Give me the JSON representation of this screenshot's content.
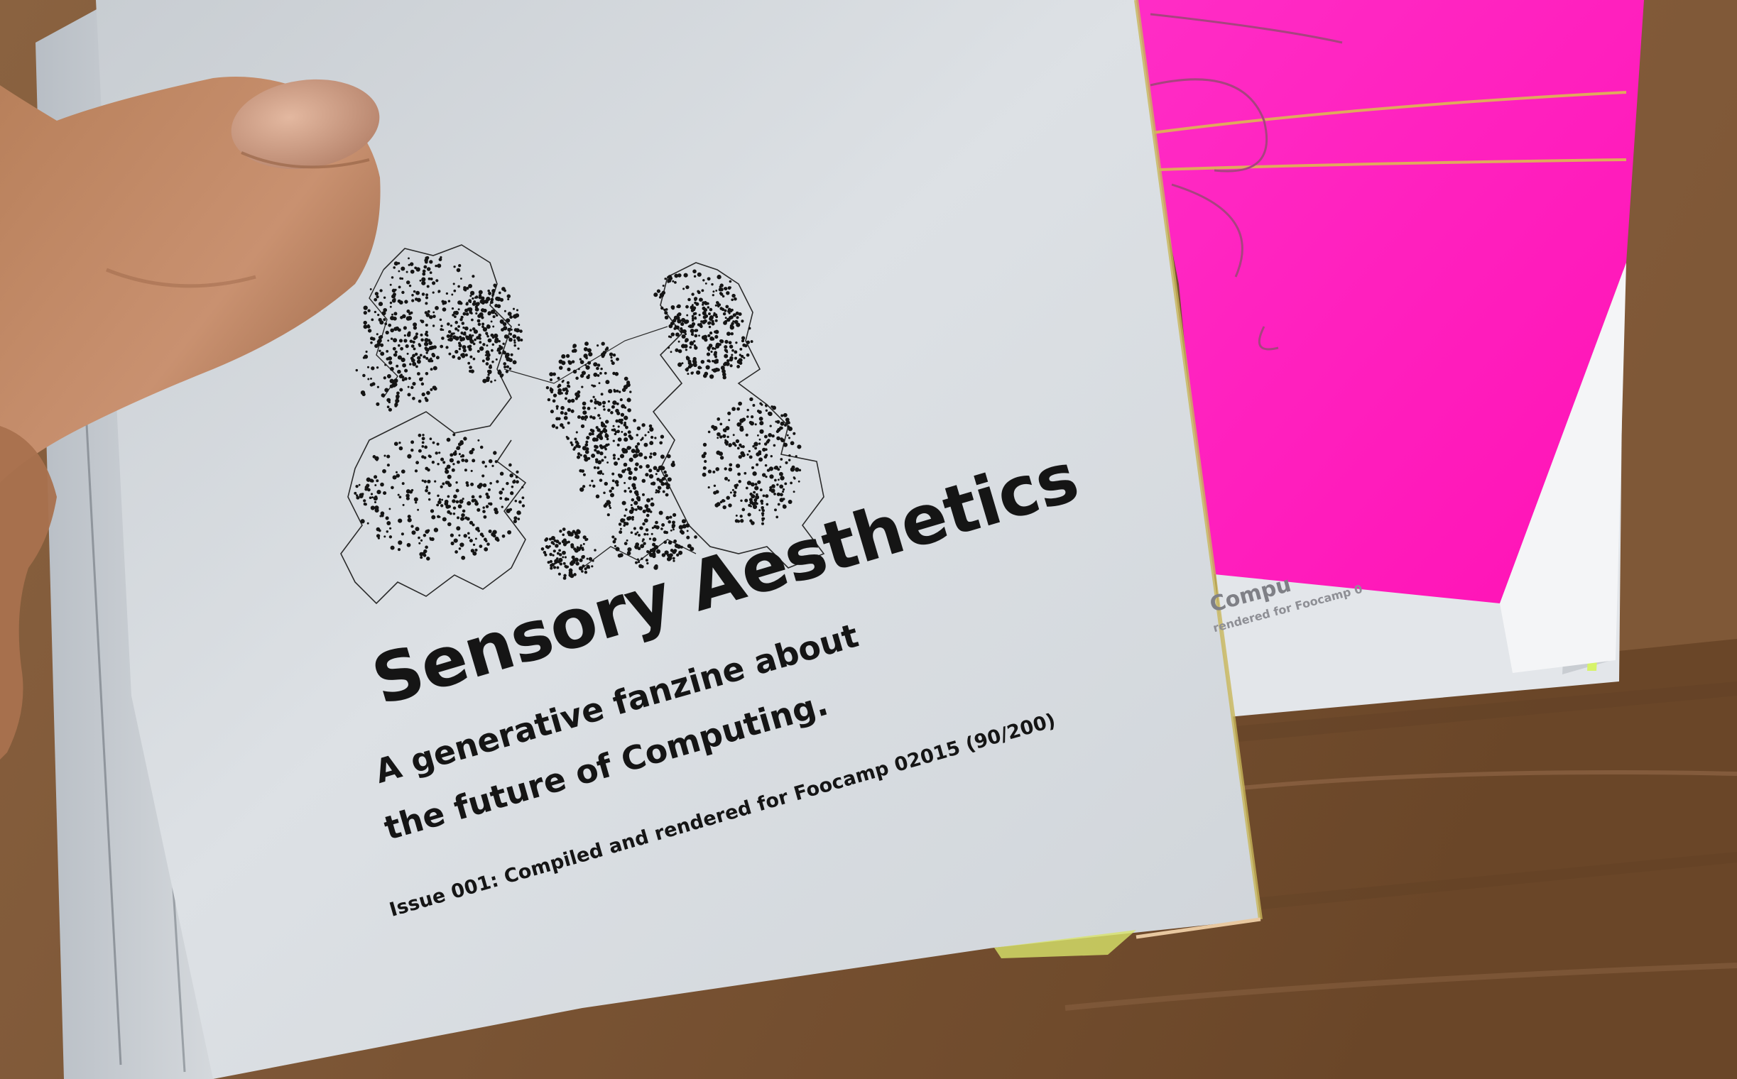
{
  "zine": {
    "title": "Sensory Aesthetics",
    "subtitle_line1": "A generative fanzine about",
    "subtitle_line2": "the future of Computing.",
    "issue_line": "Issue 001: Compiled and rendered for Foocamp 02015 (90/200)"
  },
  "back_copy": {
    "partial_title": "Compu",
    "partial_issue": "rendered for Foocamp 0"
  },
  "colors": {
    "paper": "#d9dde1",
    "neon_pink": "#ff1ec0",
    "table_wood": "#7a5434",
    "ink": "#151515"
  }
}
